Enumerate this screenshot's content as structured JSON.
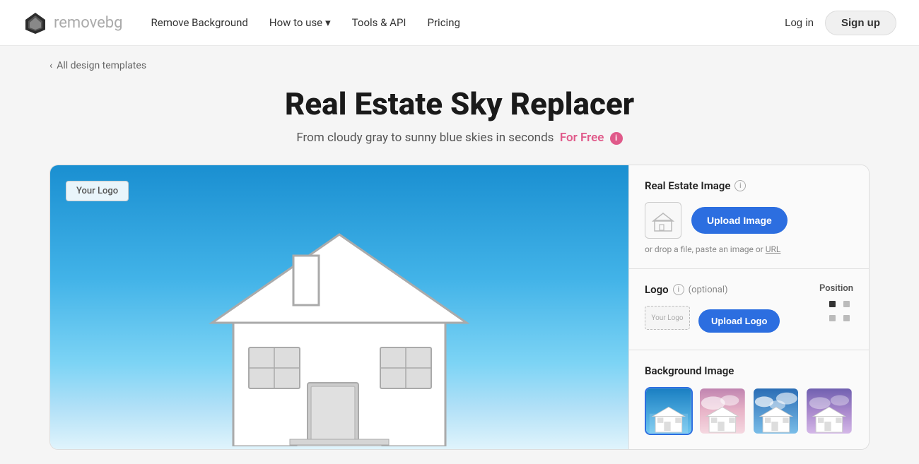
{
  "navbar": {
    "logo_text_main": "remove",
    "logo_text_accent": "bg",
    "nav": {
      "remove_bg": "Remove Background",
      "how_to_use": "How to use",
      "tools_api": "Tools & API",
      "pricing": "Pricing"
    },
    "login_label": "Log in",
    "signup_label": "Sign up"
  },
  "breadcrumb": {
    "chevron": "‹",
    "label": "All design templates"
  },
  "hero": {
    "title": "Real Estate Sky Replacer",
    "subtitle": "From cloudy gray to sunny blue skies in seconds",
    "for_free": "For Free",
    "info_symbol": "i"
  },
  "canvas": {
    "logo_badge": "Your Logo"
  },
  "right_panel": {
    "real_estate_section": {
      "title": "Real Estate Image",
      "upload_btn": "Upload Image",
      "drop_hint": "or drop a file, paste an image or",
      "url_label": "URL"
    },
    "logo_section": {
      "title": "Logo",
      "optional": "(optional)",
      "upload_btn": "Upload Logo",
      "logo_placeholder_text": "Your Logo",
      "position_label": "Position"
    },
    "background_section": {
      "title": "Background Image"
    }
  },
  "background_thumbs": [
    {
      "id": 1,
      "sky": "blue_clear",
      "selected": true
    },
    {
      "id": 2,
      "sky": "pink_clouds"
    },
    {
      "id": 3,
      "sky": "blue_clouds"
    },
    {
      "id": 4,
      "sky": "purple_dusk"
    }
  ],
  "colors": {
    "primary_blue": "#2c6ee0",
    "for_free_pink": "#e05a8a",
    "sky_top": "#1a8fd1",
    "sky_bottom": "#b0e0f7"
  }
}
